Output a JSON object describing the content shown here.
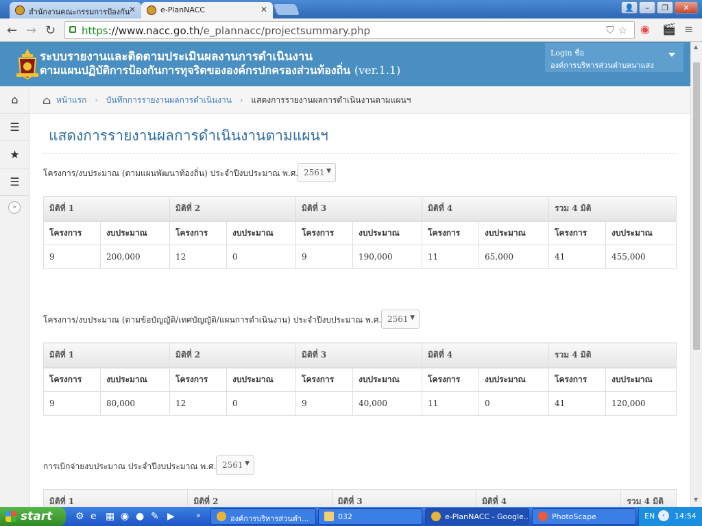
{
  "browser": {
    "tabs": [
      {
        "label": "สำนักงานคณะกรรมการป้องกัน",
        "active": false
      },
      {
        "label": "e-PlanNACC",
        "active": true
      }
    ],
    "url_scheme": "https",
    "url_host": "://www.nacc.go.th",
    "url_path": "/e_plannacc/projectsummary.php"
  },
  "header": {
    "title_line1": "ระบบรายงานและติดตามประเมินผลงานการดำเนินงาน",
    "title_line2": "ตามแผนปฏิบัติการป้องกันการทุจริตขององค์กรปกครองส่วนท้องถิ่น",
    "version": "(ver.1.1)",
    "login_label": "Login ชื่อ",
    "login_org": "องค์การบริหารส่วนตำบลนาแสง"
  },
  "breadcrumb": {
    "home": "หน้าแรก",
    "item2": "บันทึกการรายงานผลการดำเนินงาน",
    "current": "แสดงการรายงานผลการดำเนินงานตามแผนฯ"
  },
  "page": {
    "title": "แสดงการรายงานผลการดำเนินงานตามแผนฯ"
  },
  "sections": [
    {
      "label": "โครงการ/งบประมาณ (ตามแผนพัฒนาท้องถิ่น) ประจำปีงบประมาณ พ.ศ.",
      "year": "2561",
      "dims": [
        "มิติที่ 1",
        "มิติที่ 2",
        "มิติที่ 3",
        "มิติที่ 4",
        "รวม 4 มิติ"
      ],
      "subheaders": [
        "โครงการ",
        "งบประมาณ",
        "โครงการ",
        "งบประมาณ",
        "โครงการ",
        "งบประมาณ",
        "โครงการ",
        "งบประมาณ",
        "โครงการ",
        "งบประมาณ"
      ],
      "values": [
        "9",
        "200,000",
        "12",
        "0",
        "9",
        "190,000",
        "11",
        "65,000",
        "41",
        "455,000"
      ]
    },
    {
      "label": "โครงการ/งบประมาณ (ตามข้อบัญญัติ/เทศบัญญัติ/แผนการดำเนินงาน) ประจำปีงบประมาณ พ.ศ.",
      "year": "2561",
      "dims": [
        "มิติที่ 1",
        "มิติที่ 2",
        "มิติที่ 3",
        "มิติที่ 4",
        "รวม 4 มิติ"
      ],
      "subheaders": [
        "โครงการ",
        "งบประมาณ",
        "โครงการ",
        "งบประมาณ",
        "โครงการ",
        "งบประมาณ",
        "โครงการ",
        "งบประมาณ",
        "โครงการ",
        "งบประมาณ"
      ],
      "values": [
        "9",
        "80,000",
        "12",
        "0",
        "9",
        "40,000",
        "11",
        "0",
        "41",
        "120,000"
      ]
    },
    {
      "label": "การเบิกจ่ายงบประมาณ ประจำปีงบประมาณ พ.ศ.",
      "year": "2561",
      "dims": [
        "มิติที่ 1",
        "มิติที่ 2",
        "มิติที่ 3",
        "มิติที่ 4",
        "รวม 4 มิติ"
      ]
    }
  ],
  "taskbar": {
    "start": "start",
    "tasks": [
      "องค์การบริหารส่วนตำ...",
      "032",
      "e-PlanNACC - Google...",
      "PhotoScape"
    ],
    "lang": "EN",
    "clock": "14:54"
  },
  "colors": {
    "header_bg": "#4a8fc1",
    "title_blue": "#2e6da4",
    "link_blue": "#3a7ab6"
  }
}
